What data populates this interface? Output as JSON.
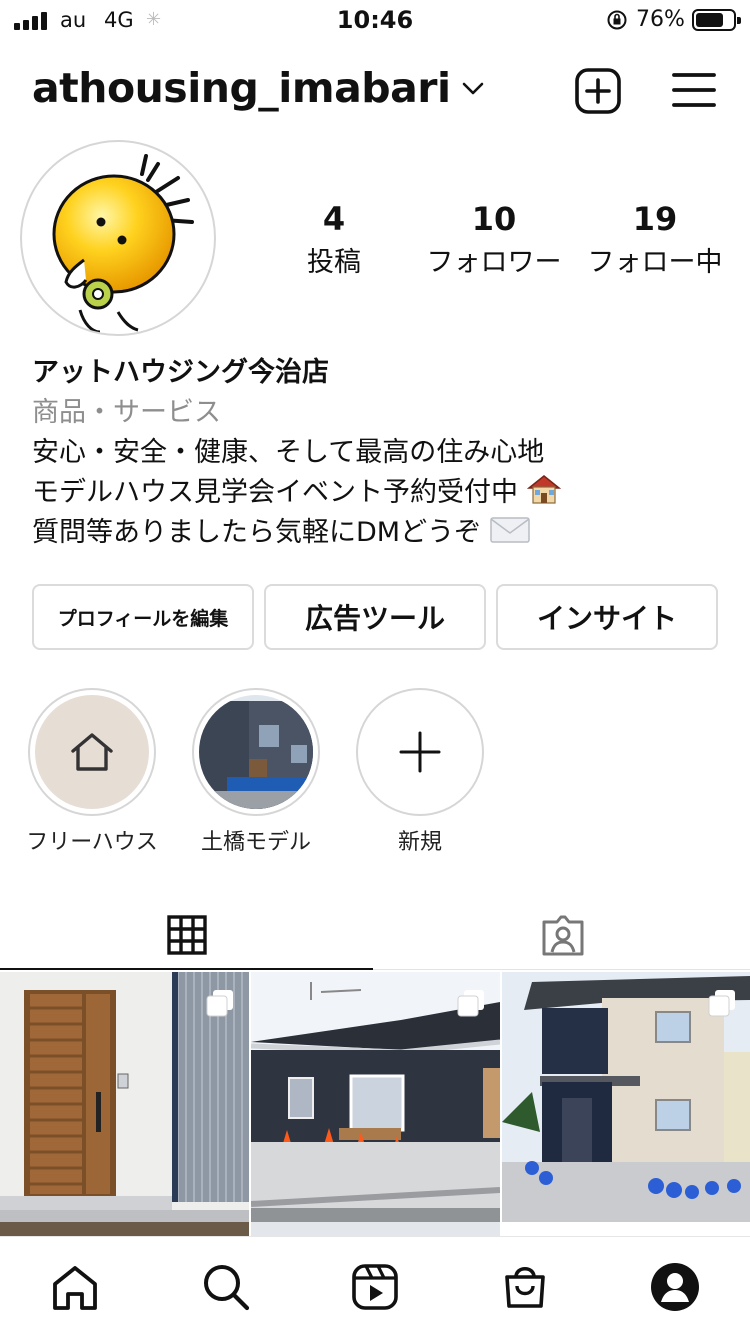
{
  "status_bar": {
    "carrier": "au",
    "network": "4G",
    "time": "10:46",
    "battery_percent": "76%",
    "battery_level": 0.76
  },
  "profile": {
    "username": "athousing_imabari",
    "stats": [
      {
        "value": "4",
        "label": "投稿"
      },
      {
        "value": "10",
        "label": "フォロワー"
      },
      {
        "value": "19",
        "label": "フォロー中"
      }
    ],
    "display_name": "アットハウジング今治店",
    "category": "商品・サービス",
    "bio_lines": [
      "安心・安全・健康、そして最高の住み心地",
      "モデルハウス見学会イベント予約受付中",
      "質問等ありましたら気軽にDMどうぞ"
    ],
    "bio_emojis": [
      "house-emoji",
      "envelope-emoji"
    ]
  },
  "buttons": {
    "edit_profile": "プロフィールを編集",
    "ad_tools": "広告ツール",
    "insights": "インサイト"
  },
  "highlights": [
    {
      "label": "フリーハウス",
      "icon": "home-outline-icon"
    },
    {
      "label": "土橋モデル",
      "icon": "house-photo"
    },
    {
      "label": "新規",
      "icon": "plus-icon"
    }
  ],
  "tabs": [
    {
      "name": "grid",
      "icon": "grid-icon",
      "active": true
    },
    {
      "name": "tagged",
      "icon": "tagged-person-icon",
      "active": false
    }
  ],
  "posts": [
    {
      "subject": "wooden-front-door",
      "multi": true
    },
    {
      "subject": "dark-single-story-house",
      "multi": true
    },
    {
      "subject": "two-story-house",
      "multi": true
    }
  ],
  "bottom_nav": [
    "home-icon",
    "search-icon",
    "reels-icon",
    "shop-icon",
    "profile-icon"
  ],
  "colors": {
    "text": "#111111",
    "secondary": "#8e8e8e",
    "border": "#dbdbdb"
  }
}
